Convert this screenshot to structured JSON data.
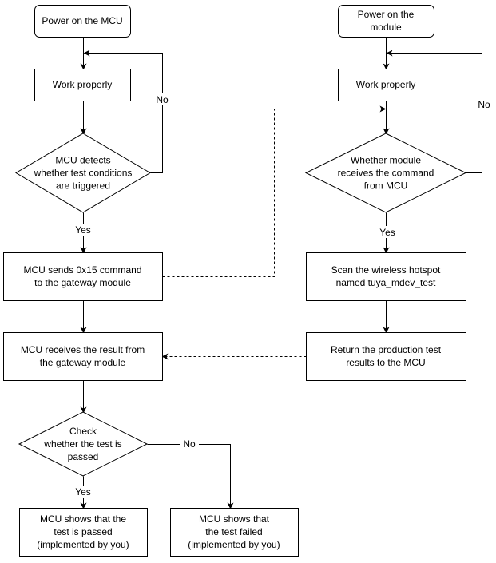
{
  "diagram": {
    "type": "flowchart",
    "nodes": [
      {
        "id": "mcu_power",
        "shape": "rounded",
        "lines": [
          "Power on the MCU"
        ]
      },
      {
        "id": "mcu_work",
        "shape": "rect",
        "lines": [
          "Work properly"
        ]
      },
      {
        "id": "mcu_detect",
        "shape": "diamond",
        "lines": [
          "MCU detects",
          "whether test conditions",
          "are triggered"
        ]
      },
      {
        "id": "mcu_send",
        "shape": "rect",
        "lines": [
          "MCU sends 0x15 command",
          "to the gateway module"
        ]
      },
      {
        "id": "mcu_receive",
        "shape": "rect",
        "lines": [
          "MCU receives the result from",
          "the gateway module"
        ]
      },
      {
        "id": "check_pass",
        "shape": "diamond",
        "lines": [
          "Check",
          "whether the test is",
          "passed"
        ]
      },
      {
        "id": "show_pass",
        "shape": "rect",
        "lines": [
          "MCU shows that the",
          "test is passed",
          "(implemented by you)"
        ]
      },
      {
        "id": "show_fail",
        "shape": "rect",
        "lines": [
          "MCU shows that",
          "the test failed",
          "(implemented by you)"
        ]
      },
      {
        "id": "mod_power",
        "shape": "rounded",
        "lines": [
          "Power on the",
          "module"
        ]
      },
      {
        "id": "mod_work",
        "shape": "rect",
        "lines": [
          "Work properly"
        ]
      },
      {
        "id": "mod_receive",
        "shape": "diamond",
        "lines": [
          "Whether module",
          "receives the command",
          "from MCU"
        ]
      },
      {
        "id": "mod_scan",
        "shape": "rect",
        "lines": [
          "Scan the wireless hotspot",
          "named tuya_mdev_test"
        ]
      },
      {
        "id": "mod_return",
        "shape": "rect",
        "lines": [
          "Return the production test",
          "results to the MCU"
        ]
      }
    ],
    "edges": [
      {
        "from": "mcu_power",
        "to": "mcu_work",
        "style": "solid",
        "label": ""
      },
      {
        "from": "mcu_work",
        "to": "mcu_detect",
        "style": "solid",
        "label": ""
      },
      {
        "from": "mcu_detect",
        "to": "mcu_work",
        "style": "solid",
        "label": "No"
      },
      {
        "from": "mcu_detect",
        "to": "mcu_send",
        "style": "solid",
        "label": "Yes"
      },
      {
        "from": "mcu_send",
        "to": "mcu_receive",
        "style": "solid",
        "label": ""
      },
      {
        "from": "mcu_send",
        "to": "mod_receive",
        "style": "dashed",
        "label": ""
      },
      {
        "from": "mcu_receive",
        "to": "check_pass",
        "style": "solid",
        "label": ""
      },
      {
        "from": "check_pass",
        "to": "show_pass",
        "style": "solid",
        "label": "Yes"
      },
      {
        "from": "check_pass",
        "to": "show_fail",
        "style": "solid",
        "label": "No"
      },
      {
        "from": "mod_power",
        "to": "mod_work",
        "style": "solid",
        "label": ""
      },
      {
        "from": "mod_work",
        "to": "mod_receive",
        "style": "solid",
        "label": ""
      },
      {
        "from": "mod_receive",
        "to": "mod_work",
        "style": "solid",
        "label": "No"
      },
      {
        "from": "mod_receive",
        "to": "mod_scan",
        "style": "solid",
        "label": "Yes"
      },
      {
        "from": "mod_scan",
        "to": "mod_return",
        "style": "solid",
        "label": ""
      },
      {
        "from": "mod_return",
        "to": "mcu_receive",
        "style": "dashed",
        "label": ""
      }
    ]
  }
}
